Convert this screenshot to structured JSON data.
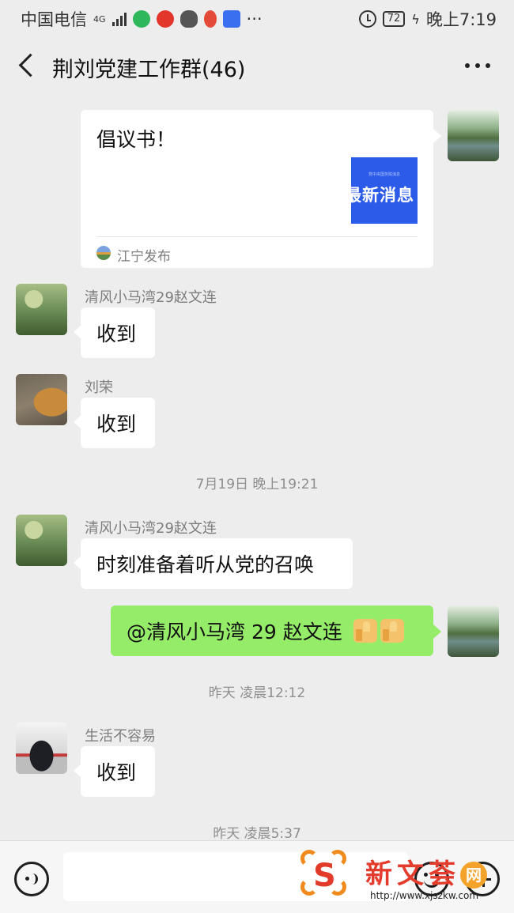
{
  "status": {
    "carrier": "中国电信",
    "network": "4G",
    "battery": "72",
    "time": "晚上7:19"
  },
  "header": {
    "title": "荆刘党建工作群(46)"
  },
  "messages": {
    "card": {
      "title": "倡议书！",
      "thumb_small": "党中央国务院消息",
      "thumb_big": "最新消息",
      "source": "江宁发布"
    },
    "m1": {
      "name": "清风小马湾29赵文连",
      "text": "收到"
    },
    "m2": {
      "name": "刘荣",
      "text": "收到"
    },
    "t1": "7月19日 晚上19:21",
    "m3": {
      "name": "清风小马湾29赵文连",
      "text": "时刻准备着听从党的召唤"
    },
    "m4": {
      "text": "@清风小马湾 29 赵文连"
    },
    "t2": "昨天 凌晨12:12",
    "m5": {
      "name": "生活不容易",
      "text": "收到"
    },
    "t3": "昨天 凌晨5:37"
  },
  "watermark": {
    "brand": "新文荟",
    "badge": "网",
    "url": "http://www.xjszkw.com"
  },
  "colors": {
    "background": "#ededed",
    "own_bubble": "#95ec69",
    "other_bubble": "#ffffff",
    "thumb_blue": "#2b5be8"
  }
}
